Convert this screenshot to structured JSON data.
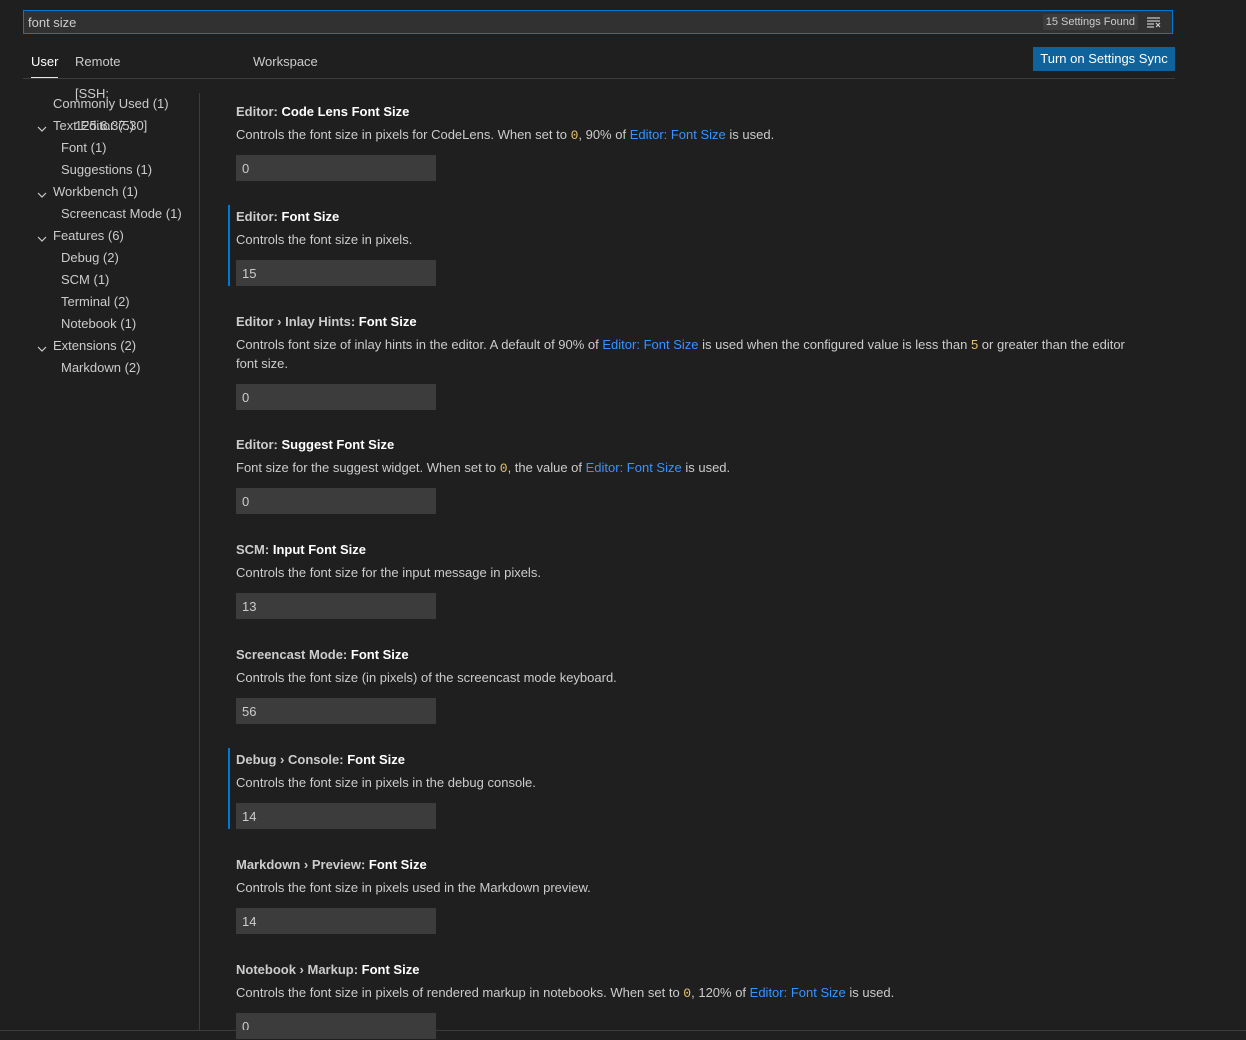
{
  "search": {
    "value": "font size",
    "results_badge": "15 Settings Found"
  },
  "tabs": [
    {
      "label": "User",
      "active": true
    },
    {
      "label": "Remote [SSH: 125.6.37.30]",
      "active": false
    },
    {
      "label": "Workspace",
      "active": false
    }
  ],
  "sync_button": "Turn on Settings Sync",
  "toc": [
    {
      "label": "Commonly Used (1)",
      "expandable": false
    },
    {
      "label": "Text Editor (5)",
      "expandable": true
    },
    {
      "label": "Font (1)",
      "expandable": false
    },
    {
      "label": "Suggestions (1)",
      "expandable": false
    },
    {
      "label": "Workbench (1)",
      "expandable": true
    },
    {
      "label": "Screencast Mode (1)",
      "expandable": false
    },
    {
      "label": "Features (6)",
      "expandable": true
    },
    {
      "label": "Debug (2)",
      "expandable": false
    },
    {
      "label": "SCM (1)",
      "expandable": false
    },
    {
      "label": "Terminal (2)",
      "expandable": false
    },
    {
      "label": "Notebook (1)",
      "expandable": false
    },
    {
      "label": "Extensions (2)",
      "expandable": true
    },
    {
      "label": "Markdown (2)",
      "expandable": false
    }
  ],
  "settings": [
    {
      "category": "Editor: ",
      "key": "Code Lens Font Size",
      "modified": false,
      "value": "0",
      "desc": [
        "Controls the font size in pixels for CodeLens. When set to ",
        "0",
        ", 90% of ",
        "Editor: Font Size",
        " is used."
      ]
    },
    {
      "category": "Editor: ",
      "key": "Font Size",
      "modified": true,
      "value": "15",
      "desc": [
        "Controls the font size in pixels."
      ]
    },
    {
      "category": "Editor › Inlay Hints: ",
      "key": "Font Size",
      "modified": false,
      "value": "0",
      "desc": [
        "Controls font size of inlay hints in the editor. A default of 90% of ",
        "Editor: Font Size",
        " is used when the configured value is less than ",
        "5",
        " or greater than the editor font size."
      ]
    },
    {
      "category": "Editor: ",
      "key": "Suggest Font Size",
      "modified": false,
      "value": "0",
      "desc": [
        "Font size for the suggest widget. When set to ",
        "0",
        ", the value of ",
        "Editor: Font Size",
        " is used."
      ]
    },
    {
      "category": "SCM: ",
      "key": "Input Font Size",
      "modified": false,
      "value": "13",
      "desc": [
        "Controls the font size for the input message in pixels."
      ]
    },
    {
      "category": "Screencast Mode: ",
      "key": "Font Size",
      "modified": false,
      "value": "56",
      "desc": [
        "Controls the font size (in pixels) of the screencast mode keyboard."
      ]
    },
    {
      "category": "Debug › Console: ",
      "key": "Font Size",
      "modified": true,
      "value": "14",
      "desc": [
        "Controls the font size in pixels in the debug console."
      ]
    },
    {
      "category": "Markdown › Preview: ",
      "key": "Font Size",
      "modified": false,
      "value": "14",
      "desc": [
        "Controls the font size in pixels used in the Markdown preview."
      ]
    },
    {
      "category": "Notebook › Markup: ",
      "key": "Font Size",
      "modified": false,
      "value": "0",
      "desc": [
        "Controls the font size in pixels of rendered markup in notebooks. When set to ",
        "0",
        ", 120% of ",
        "Editor: Font Size",
        " is used."
      ]
    }
  ],
  "colors": {
    "accent": "#0078d4",
    "link": "#3794ff",
    "code": "#e9c46a",
    "button": "#0e639c"
  }
}
